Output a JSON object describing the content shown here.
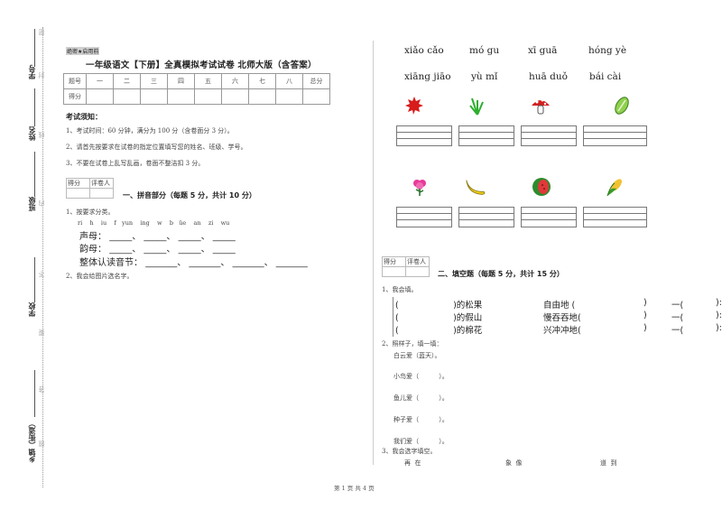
{
  "margin": {
    "labels": [
      "学号",
      "姓名",
      "班级",
      "学校",
      "乡镇（街道）"
    ],
    "cut_marks": [
      "密",
      "封",
      "线",
      "内",
      "不",
      "要",
      "答",
      "题"
    ]
  },
  "header": {
    "secret_tag": "绝密★启用前",
    "title": "一年级语文【下册】全真模拟考试试卷 北师大版（含答案）"
  },
  "score_table": {
    "row1": [
      "题号",
      "一",
      "二",
      "三",
      "四",
      "五",
      "六",
      "七",
      "八",
      "总分"
    ],
    "row2_label": "得分"
  },
  "notice": {
    "heading": "考试须知：",
    "items": [
      "1、考试时间：60 分钟，满分为 100 分（含卷面分 3 分）。",
      "2、请首先按要求在试卷的指定位置填写您的姓名、班级、学号。",
      "3、不要在试卷上乱写乱画，卷面不整洁扣 3 分。"
    ]
  },
  "grader": {
    "score": "得分",
    "reviewer": "评卷人"
  },
  "section1": {
    "title": "一、拼音部分（每题 5 分，共计 10 分）",
    "q1": "1、按要求分类。",
    "letters": "ri    h    iu    f   yun    ing    w    b   üe    an    zi    wu",
    "shengmu": "声母：",
    "yunmu": "韵母：",
    "zhengti": "整体认读音节：",
    "blank_short": "_____",
    "blank_long": "_______",
    "sep": "、",
    "q2": "2、我会给图片选名字。"
  },
  "pictures": {
    "row1_pinyin": [
      "xiǎo cǎo",
      "mó  gu",
      "xī  guā",
      "hóng yè"
    ],
    "row2_pinyin": [
      "xiāng jiāo",
      "yù  mǐ",
      "huā  duǒ",
      "bái cài"
    ],
    "row1_images": [
      "maple-leaf",
      "grass",
      "mushroom",
      "cabbage"
    ],
    "row2_images": [
      "flower",
      "banana",
      "watermelon",
      "corn"
    ]
  },
  "section2": {
    "title": "二、填空题（每题 5 分，共计 15 分）",
    "q1": "1、我会填。",
    "rows": [
      {
        "a": "(                    )的松果",
        "b": "自由地  (",
        "c": "一("
      },
      {
        "a": "(                    )的假山",
        "b": "慢吞吞地(",
        "c": "一("
      },
      {
        "a": "(                    )的棉花",
        "b": "兴冲冲地(",
        "c": "一("
      }
    ],
    "close": ")",
    "close2": "):",
    "q2": "2、照样子，填一填：",
    "example": "白云爱（蓝天）。",
    "items": [
      "小鸟爱（          ）。",
      "鱼儿爱（          ）。",
      "种子爱（          ）。",
      "我们爱（          ）。"
    ],
    "q3": "3、我会选字填空。",
    "choices": [
      "再  在",
      "象  像",
      "道  到"
    ]
  },
  "footer": {
    "page": "第 1 页 共 4 页"
  }
}
